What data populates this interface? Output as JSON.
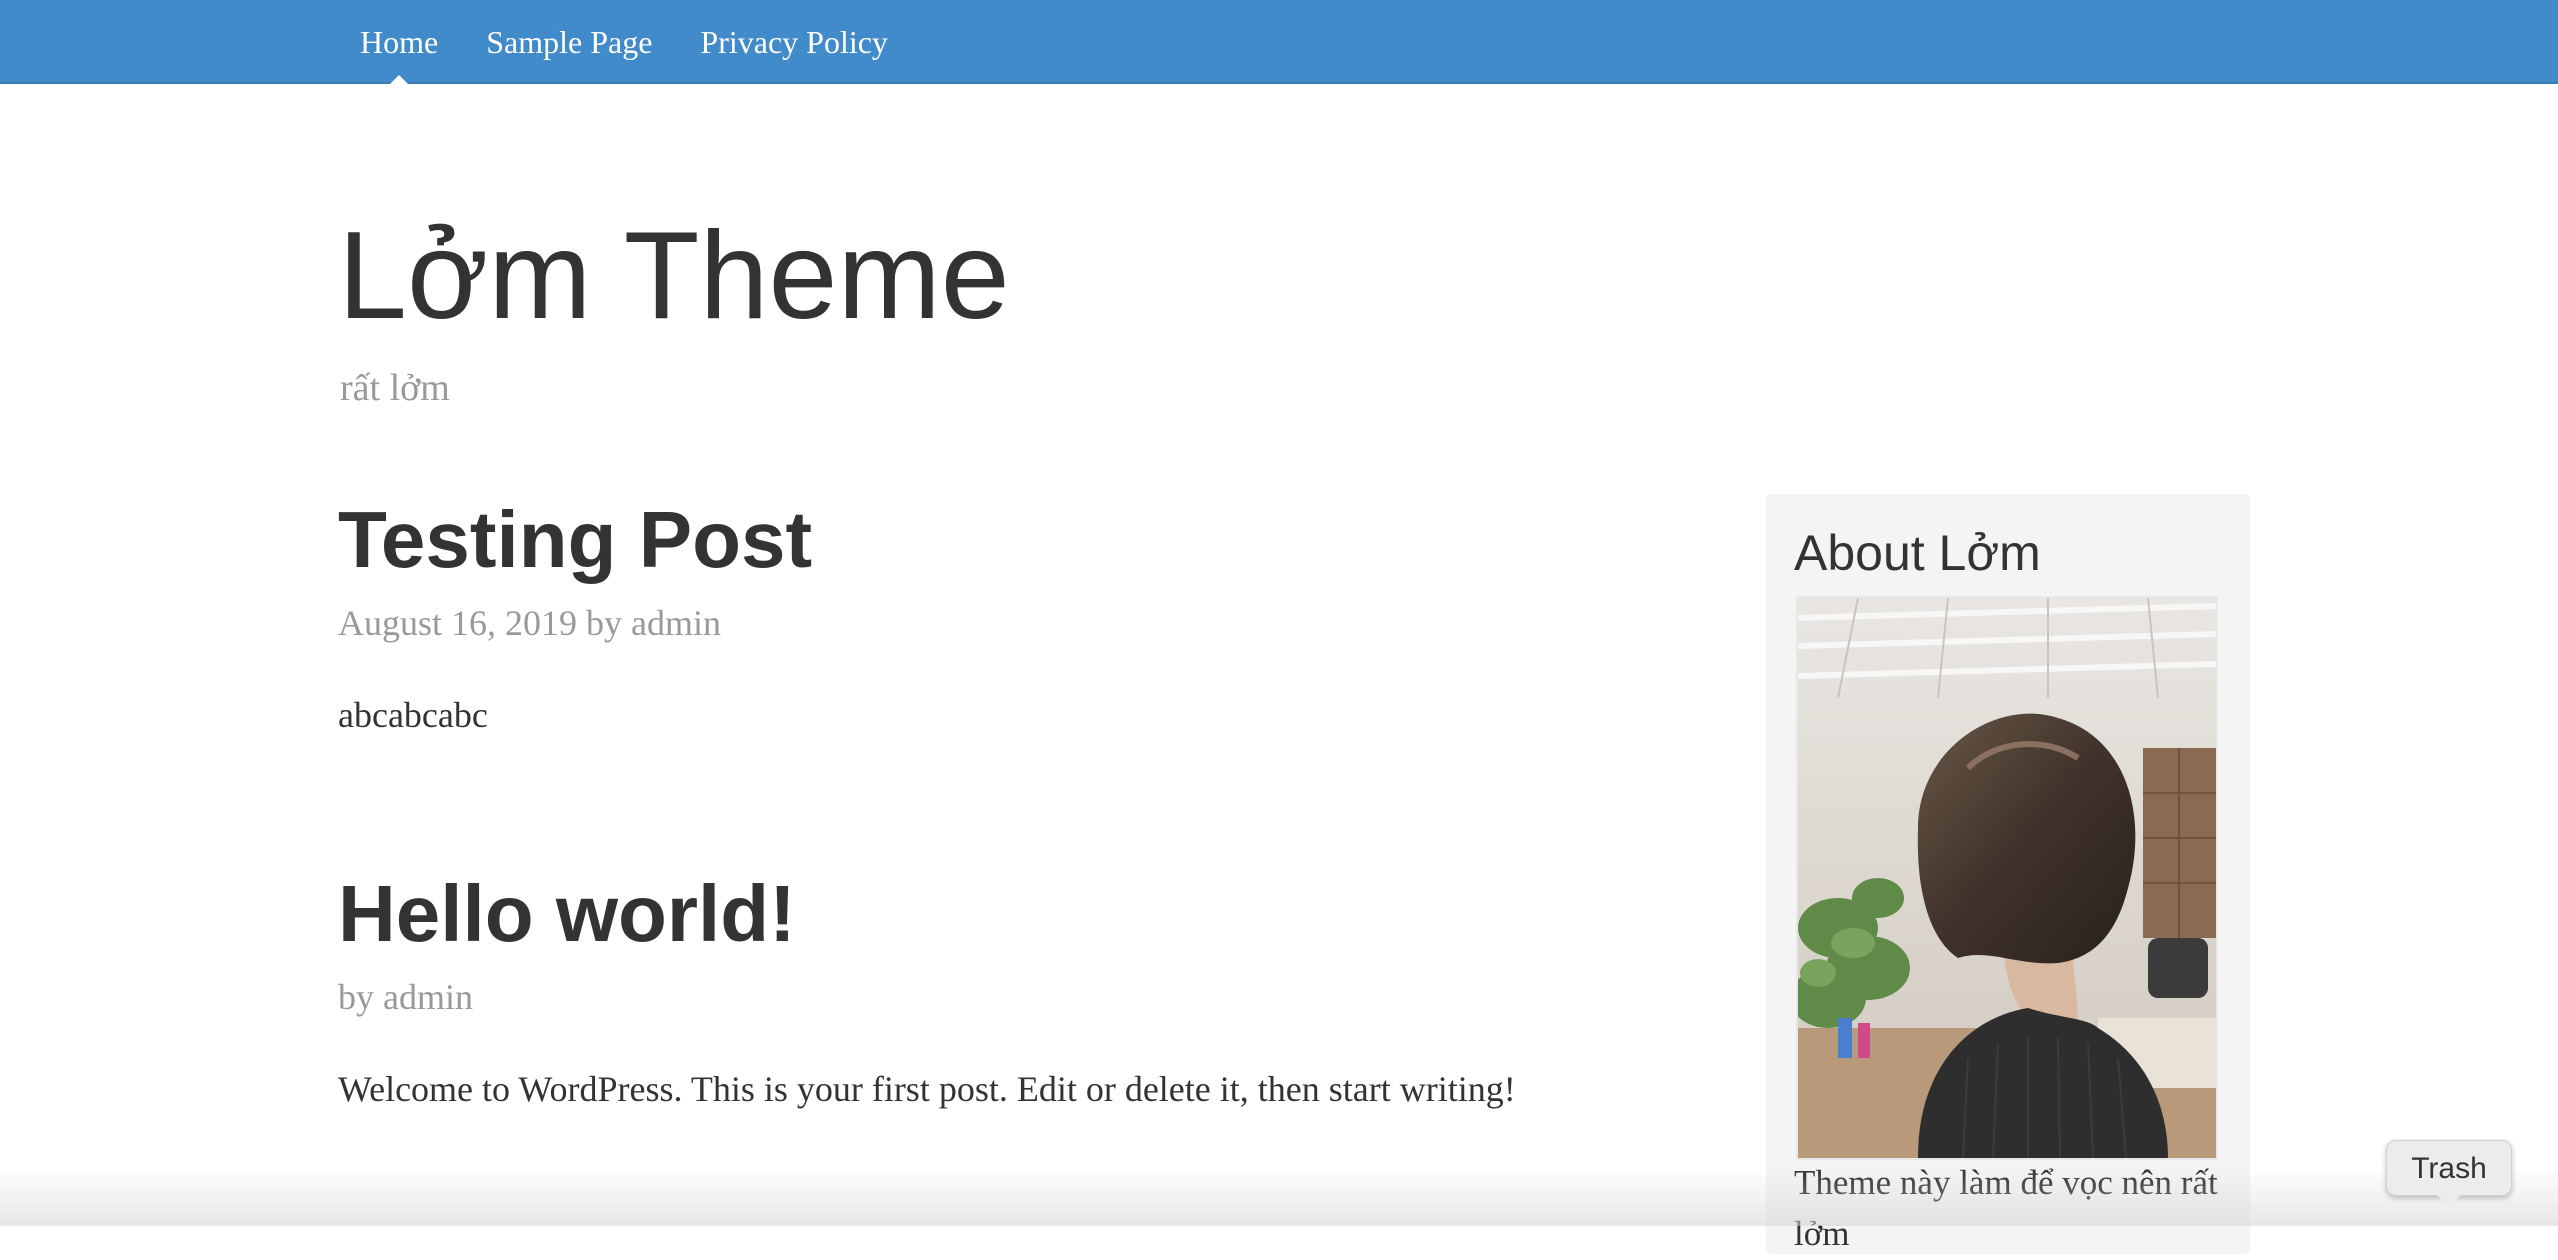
{
  "nav": {
    "items": [
      {
        "label": "Home",
        "active": true
      },
      {
        "label": "Sample Page",
        "active": false
      },
      {
        "label": "Privacy Policy",
        "active": false
      }
    ]
  },
  "site": {
    "title": "Lởm Theme",
    "tagline": "rất lởm"
  },
  "posts": [
    {
      "title": "Testing Post",
      "date": "August 16, 2019",
      "by": "by",
      "author": "admin",
      "body": "abcabcabc"
    },
    {
      "title": "Hello world!",
      "by": "by",
      "author": "admin",
      "body": "Welcome to WordPress. This is your first post. Edit or delete it, then start writing!"
    }
  ],
  "sidebar": {
    "widget_title": "About Lởm",
    "widget_text": "Theme này làm để vọc nên rất lởm"
  },
  "dock_tooltip": {
    "label": "Trash"
  },
  "colors": {
    "topbar": "#428bca",
    "text": "#333333",
    "muted": "#999999",
    "sidebar_bg": "#f4f4f4"
  }
}
